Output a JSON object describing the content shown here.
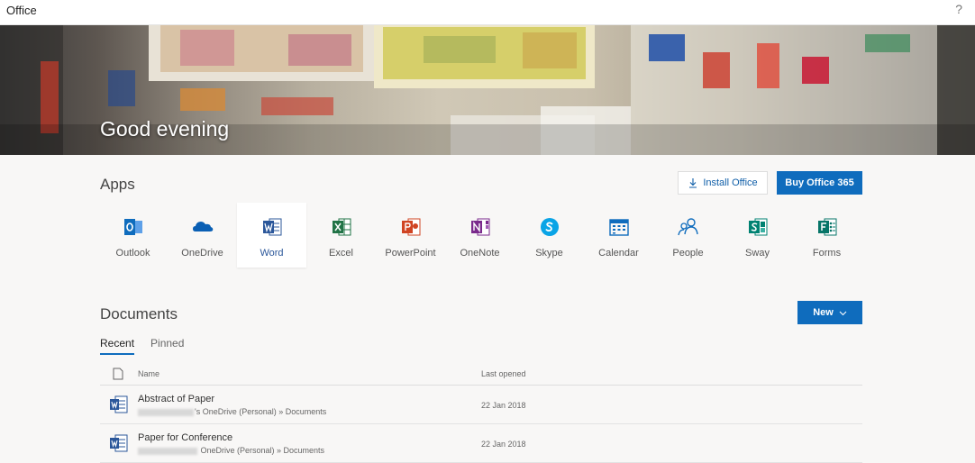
{
  "topbar": {
    "brand": "Office",
    "help": "?"
  },
  "hero": {
    "greeting": "Good evening"
  },
  "apps_section": {
    "title": "Apps",
    "install_label": "Install Office",
    "buy_label": "Buy Office 365",
    "apps": [
      {
        "label": "Outlook",
        "icon": "outlook-icon",
        "color": "#0f6cbd"
      },
      {
        "label": "OneDrive",
        "icon": "onedrive-icon",
        "color": "#0a5fb4"
      },
      {
        "label": "Word",
        "icon": "word-icon",
        "color": "#2b579a"
      },
      {
        "label": "Excel",
        "icon": "excel-icon",
        "color": "#217346"
      },
      {
        "label": "PowerPoint",
        "icon": "powerpoint-icon",
        "color": "#d04423"
      },
      {
        "label": "OneNote",
        "icon": "onenote-icon",
        "color": "#7a2a8c"
      },
      {
        "label": "Skype",
        "icon": "skype-icon",
        "color": "#0aa4e6"
      },
      {
        "label": "Calendar",
        "icon": "calendar-icon",
        "color": "#0f6cbd"
      },
      {
        "label": "People",
        "icon": "people-icon",
        "color": "#0f6cbd"
      },
      {
        "label": "Sway",
        "icon": "sway-icon",
        "color": "#008272"
      },
      {
        "label": "Forms",
        "icon": "forms-icon",
        "color": "#077568"
      }
    ],
    "selected": "Word"
  },
  "documents": {
    "title": "Documents",
    "new_label": "New",
    "tabs": [
      {
        "label": "Recent"
      },
      {
        "label": "Pinned"
      }
    ],
    "columns": {
      "name": "Name",
      "last_opened": "Last opened"
    },
    "rows": [
      {
        "name": "Abstract of Paper",
        "path": "'s OneDrive (Personal) » Documents",
        "date": "22 Jan 2018"
      },
      {
        "name": "Paper for Conference",
        "path": " OneDrive (Personal) » Documents",
        "date": "22 Jan 2018"
      }
    ]
  }
}
